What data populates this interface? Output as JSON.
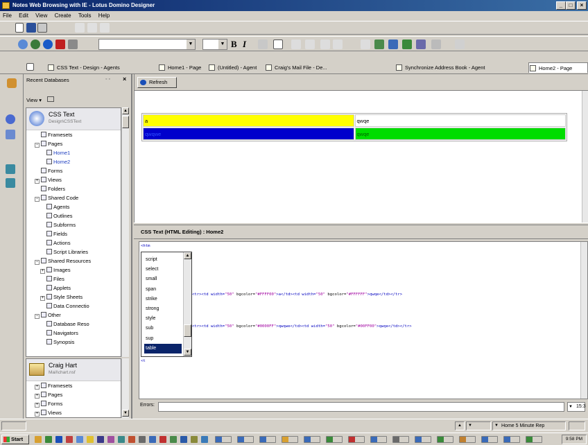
{
  "window": {
    "title": "Notes Web Browsing with IE - Lotus Domino Designer",
    "controls": [
      "_",
      "□",
      "×"
    ]
  },
  "menubar": [
    "File",
    "Edit",
    "View",
    "Create",
    "Tools",
    "Help"
  ],
  "tabs": [
    {
      "label": "CSS Text - Design - Agents"
    },
    {
      "label": "Home1 - Page"
    },
    {
      "label": "(Untitled) - Agent"
    },
    {
      "label": "Craig's Mail File - De..."
    },
    {
      "label": "Synchronize Address Book - Agent"
    },
    {
      "label": "Home2 - Page",
      "active": true
    }
  ],
  "left_panel": {
    "header": "Recent Databases",
    "view_label": "View",
    "db1": {
      "name": "CSS Text",
      "subtitle": "Design\\CSSText",
      "tree": [
        {
          "label": "Framesets",
          "indent": 1,
          "expander": ""
        },
        {
          "label": "Pages",
          "indent": 1,
          "expander": "−"
        },
        {
          "label": "Home1",
          "indent": 2,
          "expander": "",
          "blue": true
        },
        {
          "label": "Home2",
          "indent": 2,
          "expander": "",
          "blue": true
        },
        {
          "label": "Forms",
          "indent": 1,
          "expander": ""
        },
        {
          "label": "Views",
          "indent": 1,
          "expander": "+"
        },
        {
          "label": "Folders",
          "indent": 1,
          "expander": ""
        },
        {
          "label": "Shared Code",
          "indent": 1,
          "expander": "−"
        },
        {
          "label": "Agents",
          "indent": 2,
          "expander": ""
        },
        {
          "label": "Outlines",
          "indent": 2,
          "expander": ""
        },
        {
          "label": "Subforms",
          "indent": 2,
          "expander": ""
        },
        {
          "label": "Fields",
          "indent": 2,
          "expander": ""
        },
        {
          "label": "Actions",
          "indent": 2,
          "expander": ""
        },
        {
          "label": "Script Libraries",
          "indent": 2,
          "expander": ""
        },
        {
          "label": "Shared Resources",
          "indent": 1,
          "expander": "−"
        },
        {
          "label": "Images",
          "indent": 2,
          "expander": "+"
        },
        {
          "label": "Files",
          "indent": 2,
          "expander": ""
        },
        {
          "label": "Applets",
          "indent": 2,
          "expander": ""
        },
        {
          "label": "Style Sheets",
          "indent": 2,
          "expander": "+"
        },
        {
          "label": "Data Connectio",
          "indent": 2,
          "expander": ""
        },
        {
          "label": "Other",
          "indent": 1,
          "expander": "−"
        },
        {
          "label": "Database Reso",
          "indent": 2,
          "expander": ""
        },
        {
          "label": "Navigators",
          "indent": 2,
          "expander": ""
        },
        {
          "label": "Synopsis",
          "indent": 2,
          "expander": ""
        }
      ]
    },
    "db2": {
      "name": "Craig Hart",
      "subtitle": "Mail\\chart.nsf",
      "tree": [
        {
          "label": "Framesets",
          "indent": 1,
          "expander": "+"
        },
        {
          "label": "Pages",
          "indent": 1,
          "expander": "+"
        },
        {
          "label": "Forms",
          "indent": 1,
          "expander": "+"
        },
        {
          "label": "Views",
          "indent": 1,
          "expander": "+"
        }
      ]
    }
  },
  "preview": {
    "refresh_label": "Refresh",
    "table": [
      [
        {
          "text": "a",
          "bg": "#FFFF00"
        },
        {
          "text": "qwqe",
          "bg": "#FFFFFF"
        }
      ],
      [
        {
          "text": "qwqwe",
          "bg": "#0000CC"
        },
        {
          "text": "qwqe",
          "bg": "#00DD00"
        }
      ]
    ]
  },
  "editor": {
    "header": "CSS Text (HTML Editing) : Home2",
    "first_line": "<htm",
    "code_lines": [
      {
        "tag": "<tr><td width=",
        "v1": "\"50\"",
        "a2": " bgcolor=",
        "v2": "\"#FFFF00\"",
        "t3": ">a</td><td width=",
        "v3": "\"50\"",
        "a4": " bgcolor=",
        "v4": "\"#FFFFFF\"",
        "t5": ">qwqe</td></tr>"
      },
      {
        "tag": "<tr><td width=",
        "v1": "\"50\"",
        "a2": " bgcolor=",
        "v2": "\"#0000FF\"",
        "t3": ">qwqwe</td><td width=",
        "v3": "\"50\"",
        "a4": " bgcolor=",
        "v4": "\"#00FF00\"",
        "t5": ">qwqe</td></tr>"
      }
    ],
    "last_line": "<t",
    "autocomplete": [
      "script",
      "select",
      "small",
      "span",
      "strike",
      "strong",
      "style",
      "sub",
      "sup",
      "table"
    ],
    "autocomplete_selected": "table",
    "errors_label": "Errors:",
    "errors_count": "15:3"
  },
  "statusbar": {
    "dropdown1": "",
    "location": "Home 5 Minute Rep"
  },
  "taskbar": {
    "start_label": "Start",
    "clock": "9:58 PM"
  },
  "colors": {
    "title_gradient_start": "#0a246a",
    "title_gradient_end": "#3a6ea5",
    "selection": "#0a246a"
  }
}
